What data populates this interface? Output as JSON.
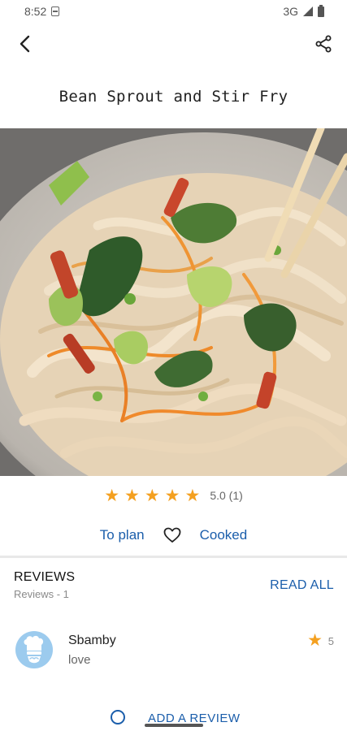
{
  "status_bar": {
    "time": "8:52",
    "network": "3G"
  },
  "app_bar": {
    "back_icon": "back-arrow-icon",
    "share_icon": "share-icon"
  },
  "recipe": {
    "title": "Bean Sprout and Stir Fry"
  },
  "rating": {
    "stars": 5,
    "text": "5.0 (1)"
  },
  "actions": {
    "plan_label": "To plan",
    "favorite_icon": "heart-icon",
    "cooked_label": "Cooked"
  },
  "reviews": {
    "title": "REVIEWS",
    "count_label": "Reviews - 1",
    "read_all_label": "READ ALL",
    "items": [
      {
        "name": "Sbamby",
        "text": "love",
        "score": "5"
      }
    ]
  },
  "add_review": {
    "label": "ADD A REVIEW"
  },
  "colors": {
    "accent": "#1b5eab",
    "star": "#f4a020",
    "avatar_bg": "#9ccbee"
  }
}
